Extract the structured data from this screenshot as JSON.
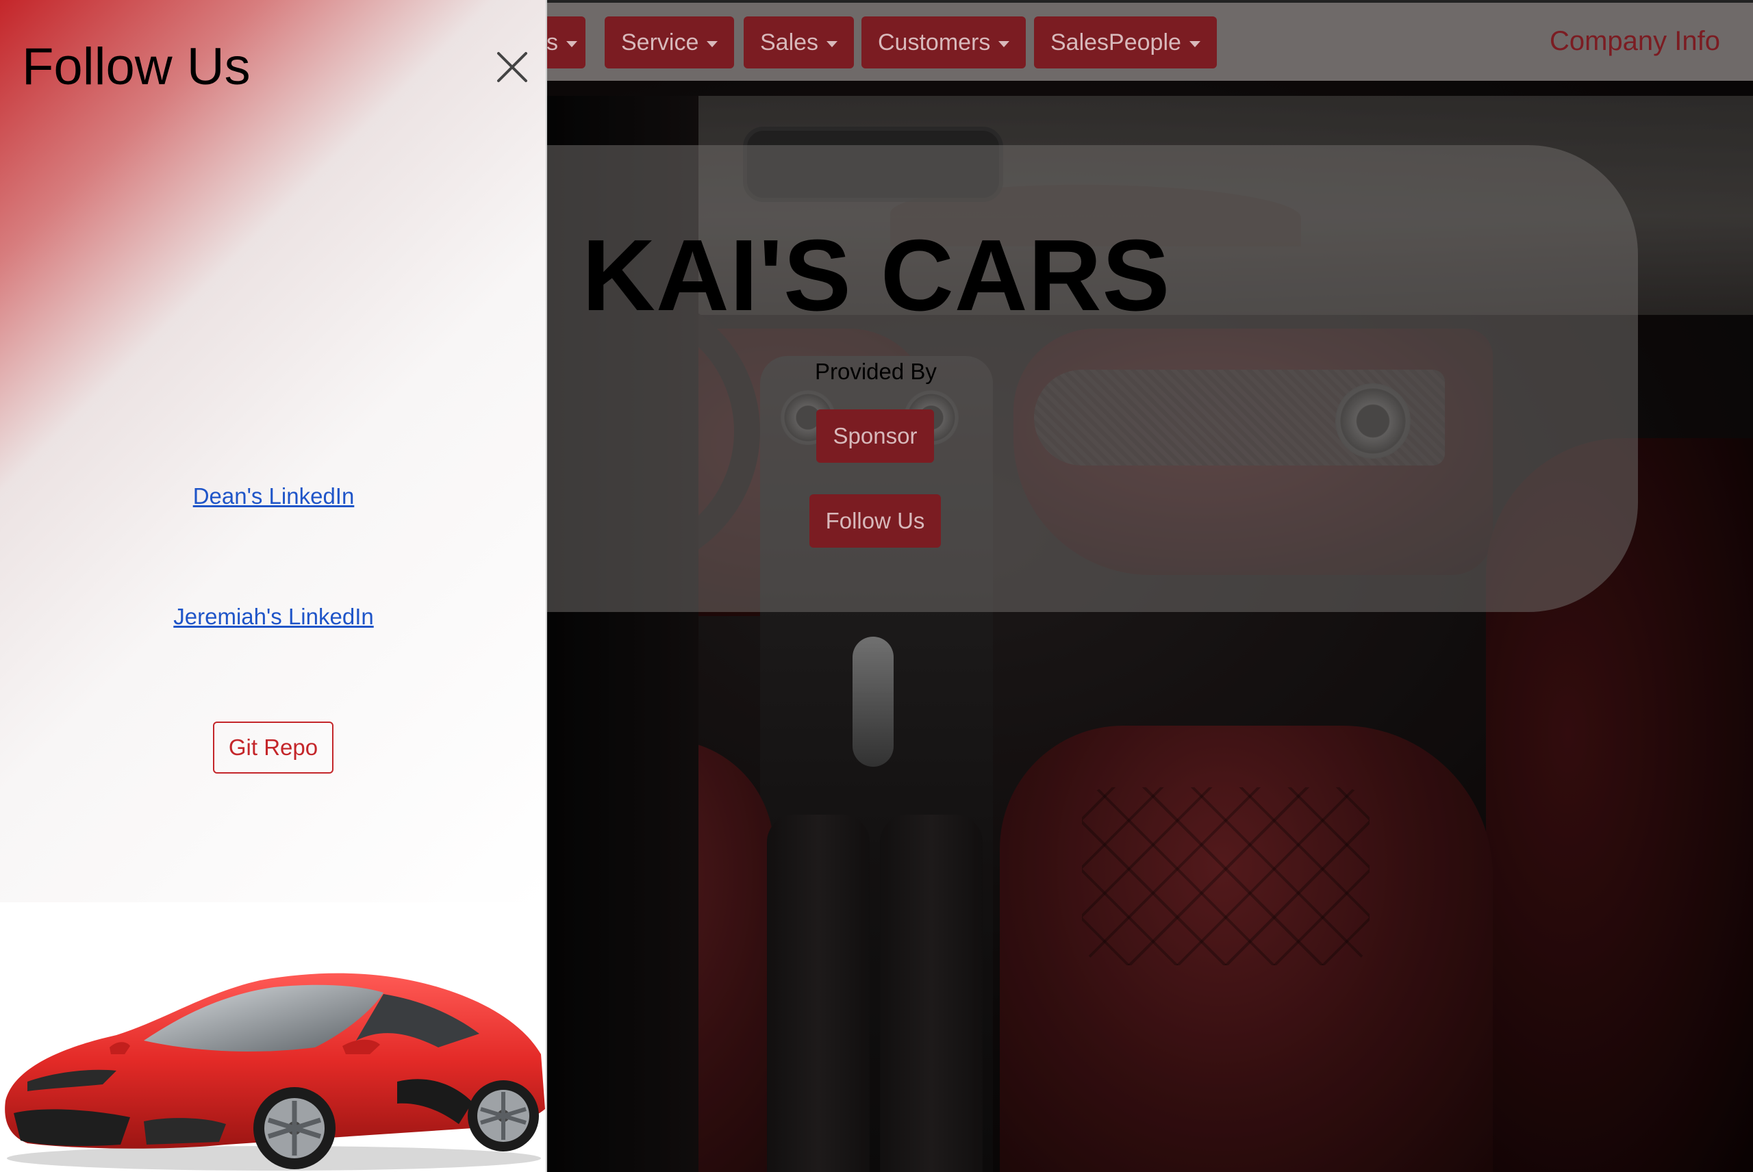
{
  "navbar": {
    "items": [
      {
        "label": "s"
      },
      {
        "label": "Service"
      },
      {
        "label": "Sales"
      },
      {
        "label": "Customers"
      },
      {
        "label": "SalesPeople"
      }
    ],
    "company_info": "Company Info"
  },
  "hero": {
    "title": "KAI'S CARS",
    "provided_by": "Provided By",
    "sponsor_label": "Sponsor",
    "follow_label": "Follow Us"
  },
  "offcanvas": {
    "title": "Follow Us",
    "links": [
      {
        "label": "Dean's LinkedIn"
      },
      {
        "label": "Jeremiah's LinkedIn"
      }
    ],
    "git_repo_label": "Git Repo",
    "close_icon": "close-icon",
    "car_image": "red-sports-car"
  },
  "colors": {
    "brand_red": "#7b1c22",
    "accent_red": "#c4262a",
    "link_blue": "#1f55c8"
  }
}
